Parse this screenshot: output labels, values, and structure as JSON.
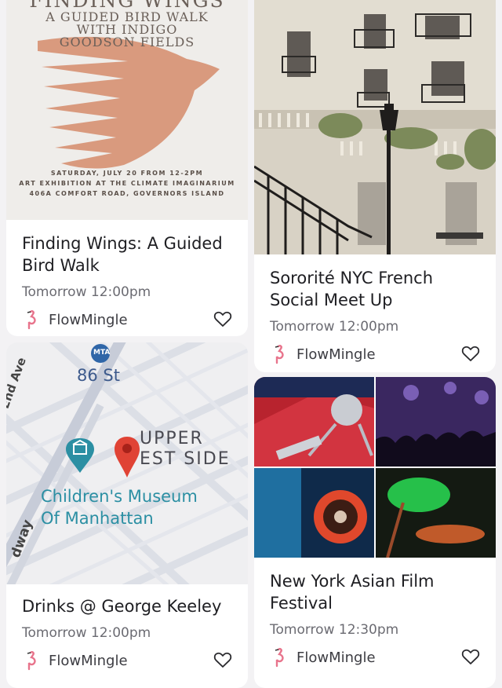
{
  "colors": {
    "background": "#f3f2f4",
    "card": "#ffffff",
    "poster_bird": "#d99a7e",
    "poster_bg": "#efedea",
    "map_blue": "#2f7d9a",
    "map_pin": "#e04335"
  },
  "events": [
    {
      "title": "Finding Wings: A Guided Bird Walk",
      "time": "Tomorrow 12:00pm",
      "organizer": "FlowMingle",
      "image": {
        "kind": "poster",
        "title": "FINDING WINGS",
        "subtitle_lines": [
          "A GUIDED BIRD WALK",
          "WITH INDIGO",
          "GOODSON FIELDS"
        ],
        "details": [
          "SATURDAY, JULY 20 FROM 12-2PM",
          "ART EXHIBITION AT THE CLIMATE IMAGINARIUM",
          "406A COMFORT ROAD, GOVERNORS ISLAND"
        ]
      }
    },
    {
      "title": "Sororité NYC French Social Meet Up",
      "time": "Tomorrow 12:00pm",
      "organizer": "FlowMingle",
      "image": {
        "kind": "photo",
        "subject": "parisian-building-facade"
      }
    },
    {
      "title": "Drinks @ George Keeley",
      "time": "Tomorrow 12:00pm",
      "organizer": "FlowMingle",
      "image": {
        "kind": "map",
        "labels": {
          "street_end_ave": "est End Ave",
          "street_86": "86 St",
          "subway": "MTA",
          "neighborhood_line1": "UPPER",
          "neighborhood_line2": "EST SIDE",
          "museum_line1": "Children's Museum",
          "museum_line2": "Of Manhattan",
          "broadway": "dway"
        }
      }
    },
    {
      "title": "New York Asian Film Festival",
      "time": "Tomorrow 12:30pm",
      "organizer": "FlowMingle",
      "image": {
        "kind": "photo-collage",
        "subject": "film-festival-collage"
      }
    }
  ]
}
